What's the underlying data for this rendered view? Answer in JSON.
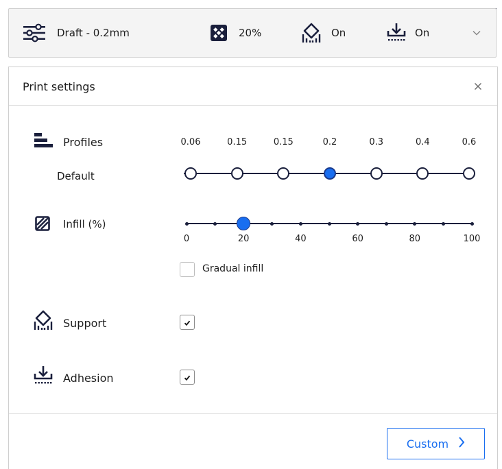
{
  "header": {
    "profile_label": "Draft - 0.2mm",
    "infill_value": "20%",
    "support_value": "On",
    "adhesion_value": "On"
  },
  "panel": {
    "title": "Print settings",
    "profiles": {
      "label": "Profiles",
      "sub_label": "Default",
      "layer_heights": [
        "0.06",
        "0.15",
        "0.15",
        "0.2",
        "0.3",
        "0.4",
        "0.6"
      ],
      "selected_index": 3
    },
    "infill": {
      "label": "Infill (%)",
      "ticks": [
        "0",
        "20",
        "40",
        "60",
        "80",
        "100"
      ],
      "value": 20,
      "min": 0,
      "max": 100,
      "step": 10,
      "gradual_label": "Gradual infill",
      "gradual_checked": false
    },
    "support": {
      "label": "Support",
      "checked": true
    },
    "adhesion": {
      "label": "Adhesion",
      "checked": true
    },
    "custom_button": "Custom"
  },
  "colors": {
    "accent": "#196ef0",
    "dark": "#1a1f3c",
    "header_bg": "#f4f4f4"
  },
  "icons": {
    "header": [
      "sliders-icon",
      "infill-pattern-icon",
      "support-icon",
      "adhesion-icon",
      "chevron-down-icon"
    ],
    "rows": [
      "layers-icon",
      "infill-icon",
      "support-icon",
      "adhesion-icon"
    ],
    "panel": [
      "close-icon",
      "chevron-right-icon",
      "checkmark-icon"
    ]
  }
}
